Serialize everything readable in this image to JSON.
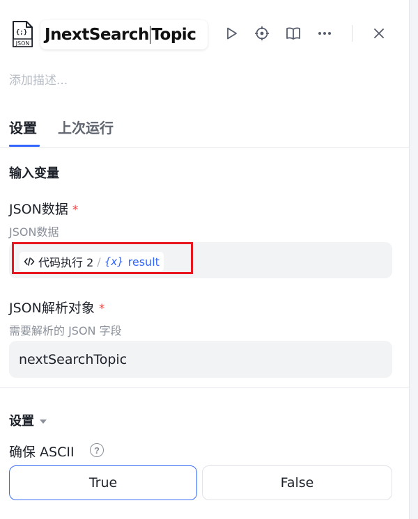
{
  "header": {
    "icon_label": "JSON",
    "icon_braces": "{;}",
    "title_prefix": "J",
    "title_mid": "nextSearch",
    "title_suffix": "Topic"
  },
  "icons": [
    "play-icon",
    "locate-icon",
    "book-icon",
    "more-icon",
    "close-icon"
  ],
  "description_placeholder": "添加描述...",
  "tabs": [
    {
      "label": "设置",
      "active": true
    },
    {
      "label": "上次运行",
      "active": false
    }
  ],
  "inputs_section": {
    "title": "输入变量",
    "json_data": {
      "label": "JSON数据",
      "required_mark": "*",
      "hint": "JSON数据",
      "node_icon": "</>",
      "node_name": "代码执行 2",
      "separator": "/",
      "var_icon": "{x}",
      "var_name": "result"
    },
    "json_target": {
      "label": "JSON解析对象",
      "required_mark": "*",
      "hint": "需要解析的 JSON 字段",
      "value": "nextSearchTopic"
    }
  },
  "settings_section": {
    "title": "设置",
    "ensure_ascii": {
      "label": "确保 ASCII",
      "help": "?",
      "options": [
        "True",
        "False"
      ],
      "selected": "True"
    }
  },
  "colors": {
    "accent": "#3366ff",
    "required": "#f53f3f",
    "highlight_box": "#e8171f"
  }
}
